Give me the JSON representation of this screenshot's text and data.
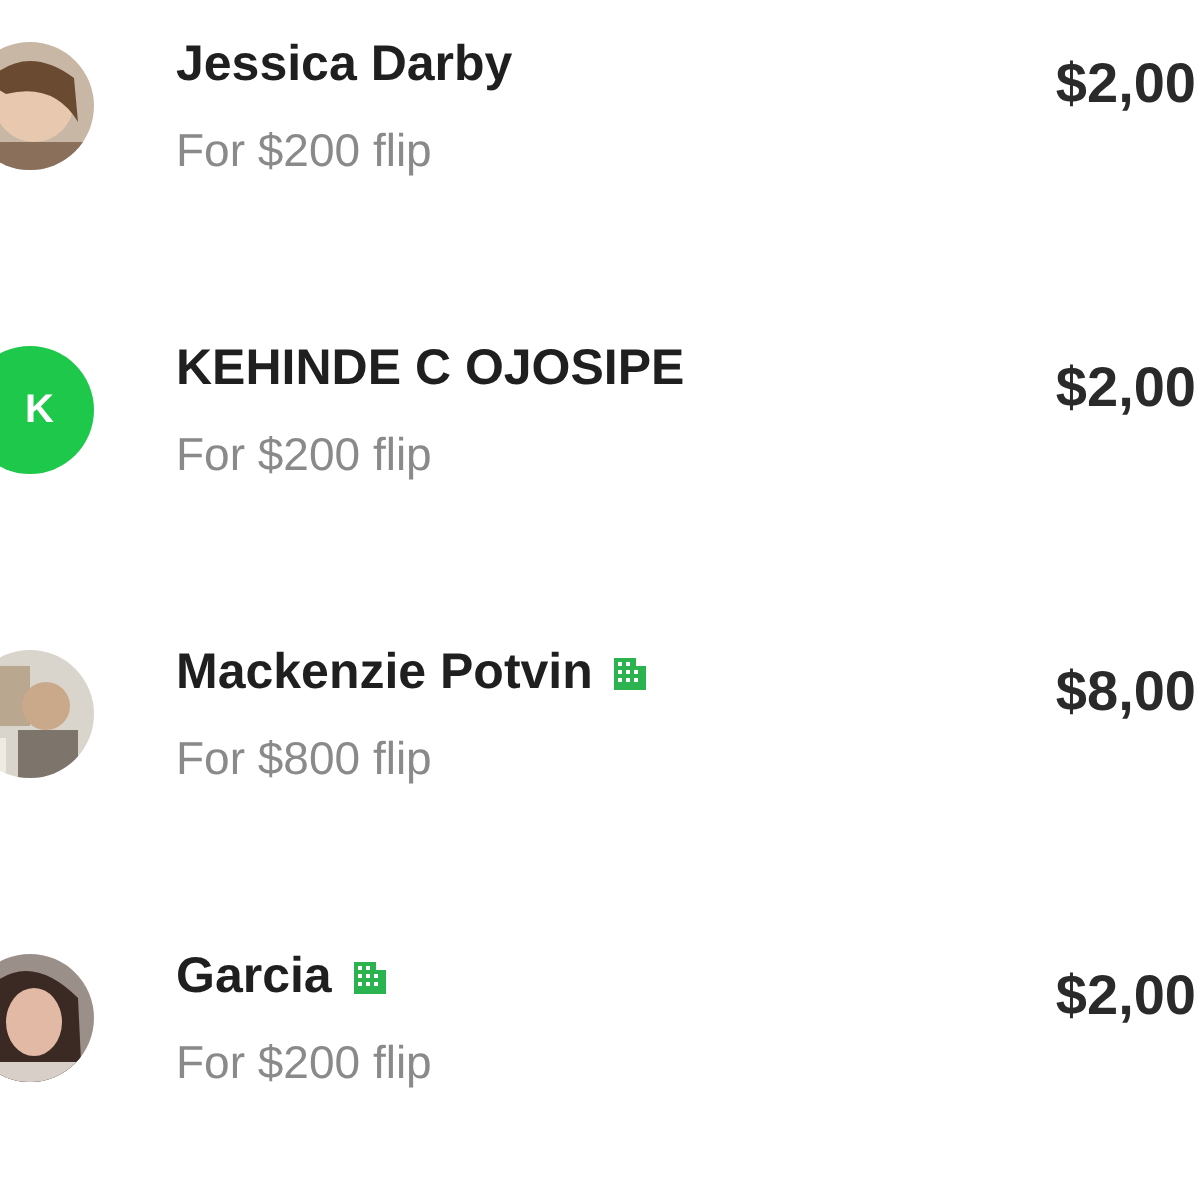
{
  "transactions": [
    {
      "name": "Jessica Darby",
      "note": "For $200 flip",
      "amount": "$2,00",
      "verified": false
    },
    {
      "name": "KEHINDE C OJOSIPE",
      "note": "For $200 flip",
      "amount": "$2,00",
      "avatar": {
        "kind": "initial",
        "text": "K"
      },
      "verified": false
    },
    {
      "name": "Mackenzie Potvin",
      "note": "For $800 flip",
      "amount": "$8,00",
      "verified": true
    },
    {
      "name": "Garcia",
      "note": "For $200 flip",
      "amount": "$2,00",
      "verified": true
    }
  ]
}
